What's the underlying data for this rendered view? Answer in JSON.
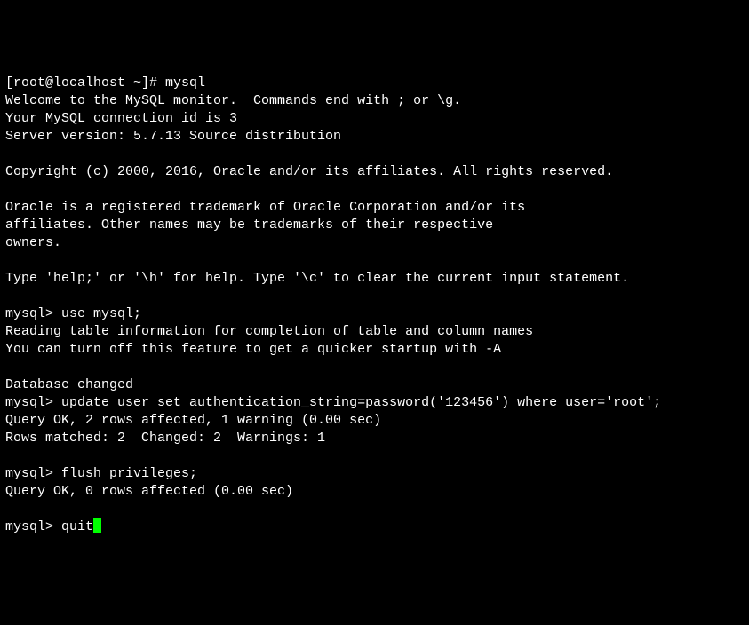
{
  "lines": {
    "l0": "[root@localhost ~]# mysql",
    "l1": "Welcome to the MySQL monitor.  Commands end with ; or \\g.",
    "l2": "Your MySQL connection id is 3",
    "l3": "Server version: 5.7.13 Source distribution",
    "l4": "",
    "l5": "Copyright (c) 2000, 2016, Oracle and/or its affiliates. All rights reserved.",
    "l6": "",
    "l7": "Oracle is a registered trademark of Oracle Corporation and/or its",
    "l8": "affiliates. Other names may be trademarks of their respective",
    "l9": "owners.",
    "l10": "",
    "l11": "Type 'help;' or '\\h' for help. Type '\\c' to clear the current input statement.",
    "l12": "",
    "l13": "mysql> use mysql;",
    "l14": "Reading table information for completion of table and column names",
    "l15": "You can turn off this feature to get a quicker startup with -A",
    "l16": "",
    "l17": "Database changed",
    "l18": "mysql> update user set authentication_string=password('123456') where user='root';",
    "l19": "Query OK, 2 rows affected, 1 warning (0.00 sec)",
    "l20": "Rows matched: 2  Changed: 2  Warnings: 1",
    "l21": "",
    "l22": "mysql> flush privileges;",
    "l23": "Query OK, 0 rows affected (0.00 sec)",
    "l24": "",
    "l25": "mysql> quit"
  }
}
